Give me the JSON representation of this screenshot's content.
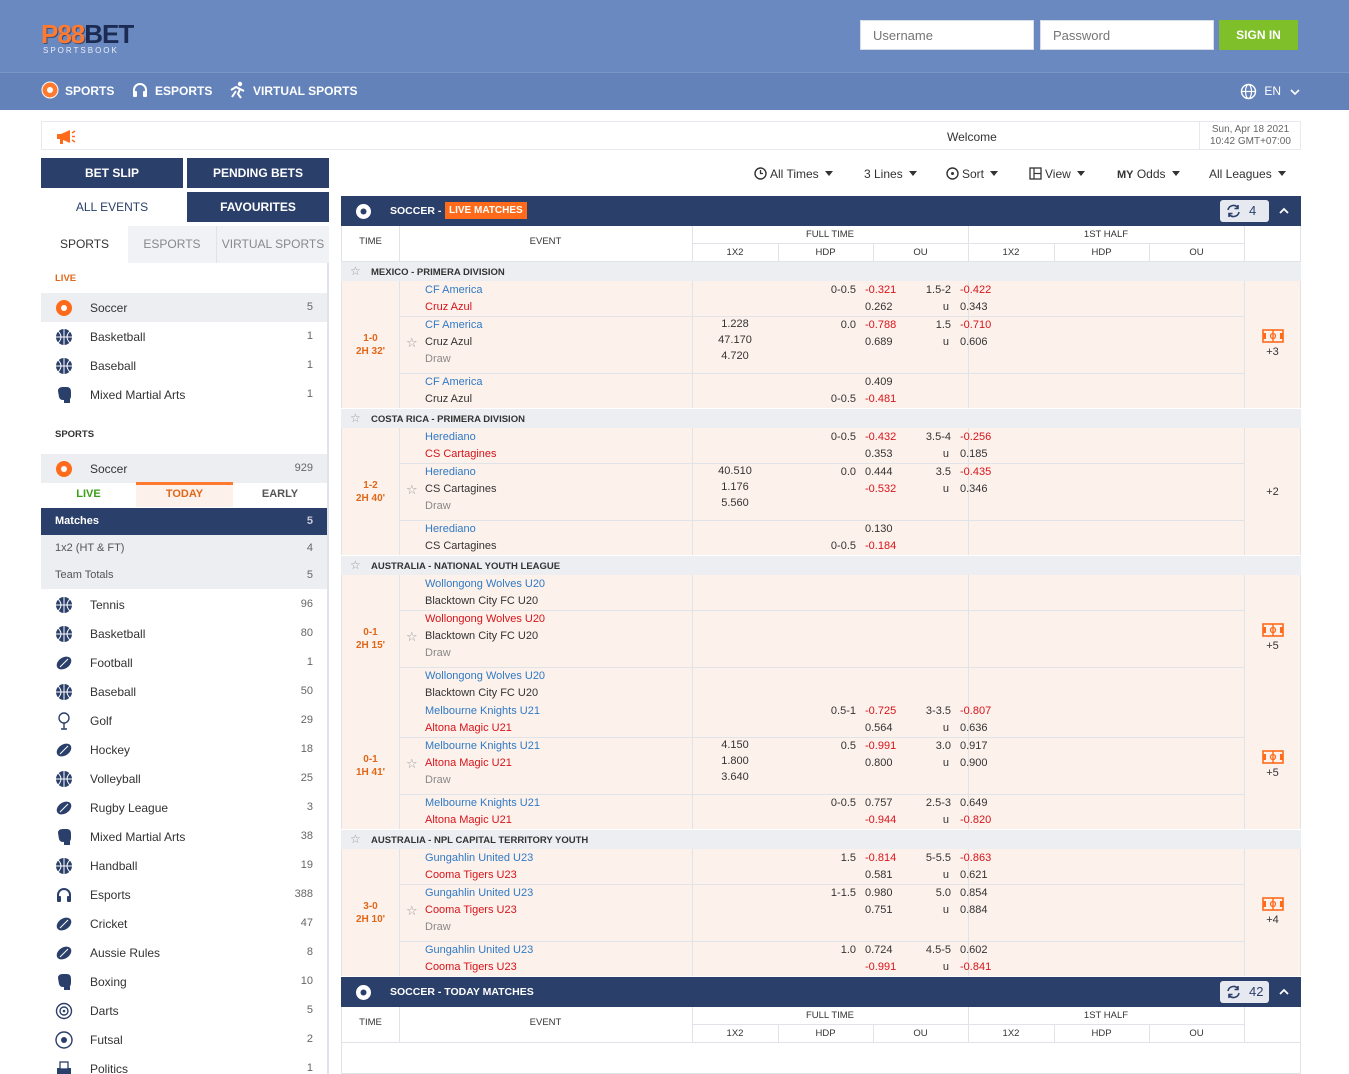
{
  "header": {
    "logo_text": "P88BET",
    "logo_sub": "SPORTSBOOK",
    "username_placeholder": "Username",
    "password_placeholder": "Password",
    "signin_label": "SIGN IN",
    "brand_color": "#6a89c0"
  },
  "nav": {
    "items": [
      "SPORTS",
      "ESPORTS",
      "VIRTUAL SPORTS"
    ],
    "lang": "EN"
  },
  "announce": {
    "welcome": "Welcome",
    "date": "Sun, Apr 18 2021",
    "time": "10:42 GMT+07:00"
  },
  "buttons": {
    "bet_slip": "BET SLIP",
    "pending_bets": "PENDING BETS",
    "all_events": "ALL EVENTS",
    "favourites": "FAVOURITES"
  },
  "sidebar": {
    "tabs": [
      "SPORTS",
      "ESPORTS",
      "VIRTUAL SPORTS"
    ],
    "live_label": "LIVE",
    "live_items": [
      {
        "name": "Soccer",
        "count": "5",
        "icon": "soccer-ball-icon"
      },
      {
        "name": "Basketball",
        "count": "1",
        "icon": "basketball-icon"
      },
      {
        "name": "Baseball",
        "count": "1",
        "icon": "baseball-icon"
      },
      {
        "name": "Mixed Martial Arts",
        "count": "1",
        "icon": "boxing-glove-icon"
      }
    ],
    "sports_label": "SPORTS",
    "soccer": {
      "name": "Soccer",
      "count": "929"
    },
    "period_tabs": [
      "LIVE",
      "TODAY",
      "EARLY"
    ],
    "sub_items": [
      {
        "name": "Matches",
        "count": "5"
      },
      {
        "name": "1x2 (HT & FT)",
        "count": "4"
      },
      {
        "name": "Team Totals",
        "count": "5"
      }
    ],
    "sports_items": [
      {
        "name": "Tennis",
        "count": "96"
      },
      {
        "name": "Basketball",
        "count": "80"
      },
      {
        "name": "Football",
        "count": "1"
      },
      {
        "name": "Baseball",
        "count": "50"
      },
      {
        "name": "Golf",
        "count": "29"
      },
      {
        "name": "Hockey",
        "count": "18"
      },
      {
        "name": "Volleyball",
        "count": "25"
      },
      {
        "name": "Rugby League",
        "count": "3"
      },
      {
        "name": "Mixed Martial Arts",
        "count": "38"
      },
      {
        "name": "Handball",
        "count": "19"
      },
      {
        "name": "Esports",
        "count": "388"
      },
      {
        "name": "Cricket",
        "count": "47"
      },
      {
        "name": "Aussie Rules",
        "count": "8"
      },
      {
        "name": "Boxing",
        "count": "10"
      },
      {
        "name": "Darts",
        "count": "5"
      },
      {
        "name": "Futsal",
        "count": "2"
      },
      {
        "name": "Politics",
        "count": "1"
      }
    ]
  },
  "filters": {
    "times": "All Times",
    "lines": "3 Lines",
    "sort": "Sort",
    "view": "View",
    "odds": "Odds",
    "odds_prefix": "MY",
    "leagues": "All Leagues"
  },
  "table_headers": {
    "time": "TIME",
    "event": "EVENT",
    "full_time": "FULL TIME",
    "first_half": "1ST HALF",
    "x12": "1X2",
    "hdp": "HDP",
    "ou": "OU"
  },
  "live_section": {
    "title": "SOCCER -",
    "badge": "LIVE MATCHES",
    "count": "4"
  },
  "today_section": {
    "title": "SOCCER - TODAY MATCHES",
    "count": "42"
  },
  "leagues": [
    "MEXICO - PRIMERA DIVISION",
    "COSTA RICA - PRIMERA DIVISION",
    "AUSTRALIA - NATIONAL YOUTH LEAGUE",
    "AUSTRALIA - NPL CAPITAL TERRITORY YOUTH"
  ],
  "matches": [
    {
      "score": "1-0",
      "clock": "2H 32'",
      "more": "+3",
      "rows": [
        {
          "home": "CF America",
          "away": "Cruz Azul",
          "hdp_line": "0-0.5",
          "hdp1": "-0.321",
          "hdp2": "0.262",
          "ou_line": "1.5-2",
          "ou1": "-0.422",
          "ou_u": "u",
          "ou2": "0.343"
        },
        {
          "home": "CF America",
          "away": "Cruz Azul",
          "draw": "Draw",
          "x1": "1.228",
          "x2": "47.170",
          "x3": "4.720",
          "hdp_line": "0.0",
          "hdp1": "-0.788",
          "hdp2": "0.689",
          "ou_line": "1.5",
          "ou1": "-0.710",
          "ou_u": "u",
          "ou2": "0.606"
        },
        {
          "home": "CF America",
          "away": "Cruz Azul",
          "hdp_line2": "0-0.5",
          "hdp1": "0.409",
          "hdp2": "-0.481"
        }
      ]
    },
    {
      "score": "1-2",
      "clock": "2H 40'",
      "more": "+2",
      "rows": [
        {
          "home": "Herediano",
          "away": "CS Cartagines",
          "hdp_line": "0-0.5",
          "hdp1": "-0.432",
          "hdp2": "0.353",
          "ou_line": "3.5-4",
          "ou1": "-0.256",
          "ou_u": "u",
          "ou2": "0.185"
        },
        {
          "home": "Herediano",
          "away": "CS Cartagines",
          "draw": "Draw",
          "x1": "40.510",
          "x2": "1.176",
          "x3": "5.560",
          "hdp_line": "0.0",
          "hdp1": "0.444",
          "hdp2": "-0.532",
          "ou_line": "3.5",
          "ou1": "-0.435",
          "ou_u": "u",
          "ou2": "0.346"
        },
        {
          "home": "Herediano",
          "away": "CS Cartagines",
          "hdp_line2": "0-0.5",
          "hdp1": "0.130",
          "hdp2": "-0.184"
        }
      ]
    },
    {
      "score": "0-1",
      "clock": "2H 15'",
      "more": "+5",
      "rows": [
        {
          "home": "Wollongong Wolves U20",
          "away": "Blacktown City FC U20"
        },
        {
          "home": "Wollongong Wolves U20",
          "away": "Blacktown City FC U20",
          "draw": "Draw"
        },
        {
          "home": "Wollongong Wolves U20",
          "away": "Blacktown City FC U20"
        }
      ]
    },
    {
      "score": "0-1",
      "clock": "1H 41'",
      "more": "+5",
      "rows": [
        {
          "home": "Melbourne Knights U21",
          "away": "Altona Magic U21",
          "hdp_line": "0.5-1",
          "hdp1": "-0.725",
          "hdp2": "0.564",
          "ou_line": "3-3.5",
          "ou1": "-0.807",
          "ou_u": "u",
          "ou2": "0.636"
        },
        {
          "home": "Melbourne Knights U21",
          "away": "Altona Magic U21",
          "draw": "Draw",
          "x1": "4.150",
          "x2": "1.800",
          "x3": "3.640",
          "hdp_line": "0.5",
          "hdp1": "-0.991",
          "hdp2": "0.800",
          "ou_line": "3.0",
          "ou1": "0.917",
          "ou_u": "u",
          "ou2": "0.900"
        },
        {
          "home": "Melbourne Knights U21",
          "away": "Altona Magic U21",
          "hdp_line": "0-0.5",
          "hdp1": "0.757",
          "hdp2": "-0.944",
          "ou_line": "2.5-3",
          "ou1": "0.649",
          "ou_u": "u",
          "ou2": "-0.820"
        }
      ]
    },
    {
      "score": "3-0",
      "clock": "2H 10'",
      "more": "+4",
      "rows": [
        {
          "home": "Gungahlin United U23",
          "away": "Cooma Tigers U23",
          "hdp_line": "1.5",
          "hdp1": "-0.814",
          "hdp2": "0.581",
          "ou_line": "5-5.5",
          "ou1": "-0.863",
          "ou_u": "u",
          "ou2": "0.621"
        },
        {
          "home": "Gungahlin United U23",
          "away": "Cooma Tigers U23",
          "draw": "Draw",
          "hdp_line": "1-1.5",
          "hdp1": "0.980",
          "hdp2": "0.751",
          "ou_line": "5.0",
          "ou1": "0.854",
          "ou_u": "u",
          "ou2": "0.884"
        },
        {
          "home": "Gungahlin United U23",
          "away": "Cooma Tigers U23",
          "hdp_line": "1.0",
          "hdp1": "0.724",
          "hdp2": "-0.991",
          "ou_line": "4.5-5",
          "ou1": "0.602",
          "ou_u": "u",
          "ou2": "-0.841"
        }
      ]
    }
  ]
}
